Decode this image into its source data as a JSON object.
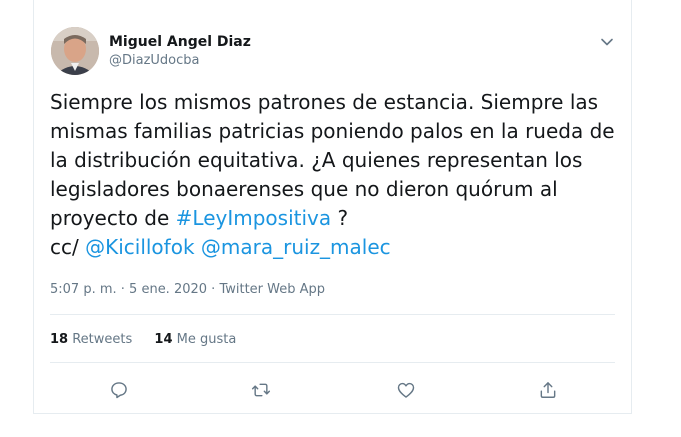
{
  "tweet": {
    "author_name": "Miguel Angel Diaz",
    "author_handle": "@DiazUdocba",
    "text_lines": [
      "Siempre los mismos patrones de estancia. Siempre las",
      "mismas familias patricias poniendo palos en la rueda de",
      "la distribución equitativa. ¿A quienes representan los",
      "legisladores bonaerenses que no dieron quórum al"
    ],
    "line5_prefix": "proyecto de ",
    "hashtag": "#LeyImpositiva",
    "line5_suffix": " ?",
    "cc_label": "cc/ ",
    "mention_1": "@Kicillofok",
    "mention_2": "@mara_ruiz_malec",
    "time": "5:07 p. m.",
    "date": "5 ene. 2020",
    "separator": " · ",
    "source": "Twitter Web App"
  },
  "stats": {
    "retweets_count": "18",
    "retweets_label": "Retweets",
    "likes_count": "14",
    "likes_label": "Me gusta"
  },
  "icons": {
    "caret": "chevron-down-icon",
    "reply": "reply-icon",
    "retweet": "retweet-icon",
    "like": "heart-icon",
    "share": "share-icon"
  },
  "colors": {
    "link": "#1b95e0",
    "secondary": "#657786",
    "text": "#14171a",
    "border": "#e6ecf0"
  }
}
